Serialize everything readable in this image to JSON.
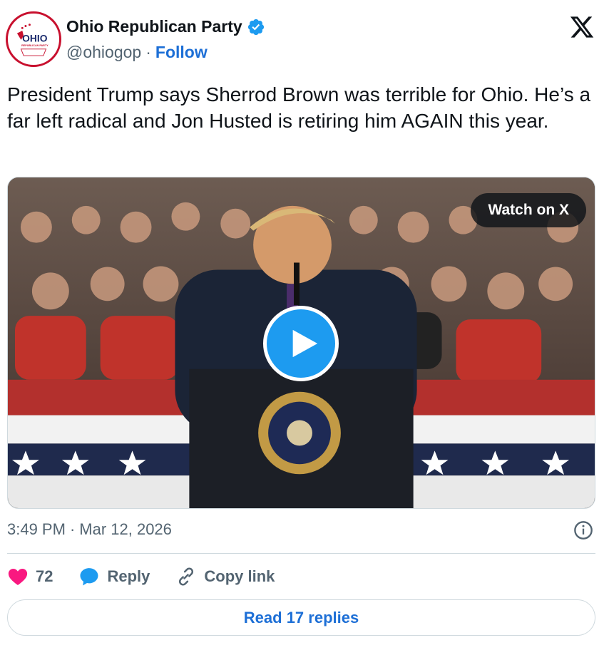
{
  "account": {
    "name": "Ohio Republican Party",
    "handle": "@ohiogop",
    "separator": "·",
    "follow_label": "Follow",
    "avatar_text": "OHIO",
    "avatar_subtext": "REPUBLICAN PARTY"
  },
  "tweet": {
    "text": "President Trump says Sherrod Brown was terrible for Ohio. He’s a far left radical and Jon Husted is retiring him AGAIN this year."
  },
  "media": {
    "watch_label": "Watch on X"
  },
  "meta": {
    "time": "3:49 PM",
    "separator": "·",
    "date": "Mar 12, 2026"
  },
  "actions": {
    "like_count": "72",
    "reply_label": "Reply",
    "copy_label": "Copy link"
  },
  "read_replies_label": "Read 17 replies",
  "colors": {
    "accent": "#1d6fd6",
    "play_button": "#1d9bf0",
    "like": "#f91880",
    "avatar_ring": "#c8102e"
  }
}
